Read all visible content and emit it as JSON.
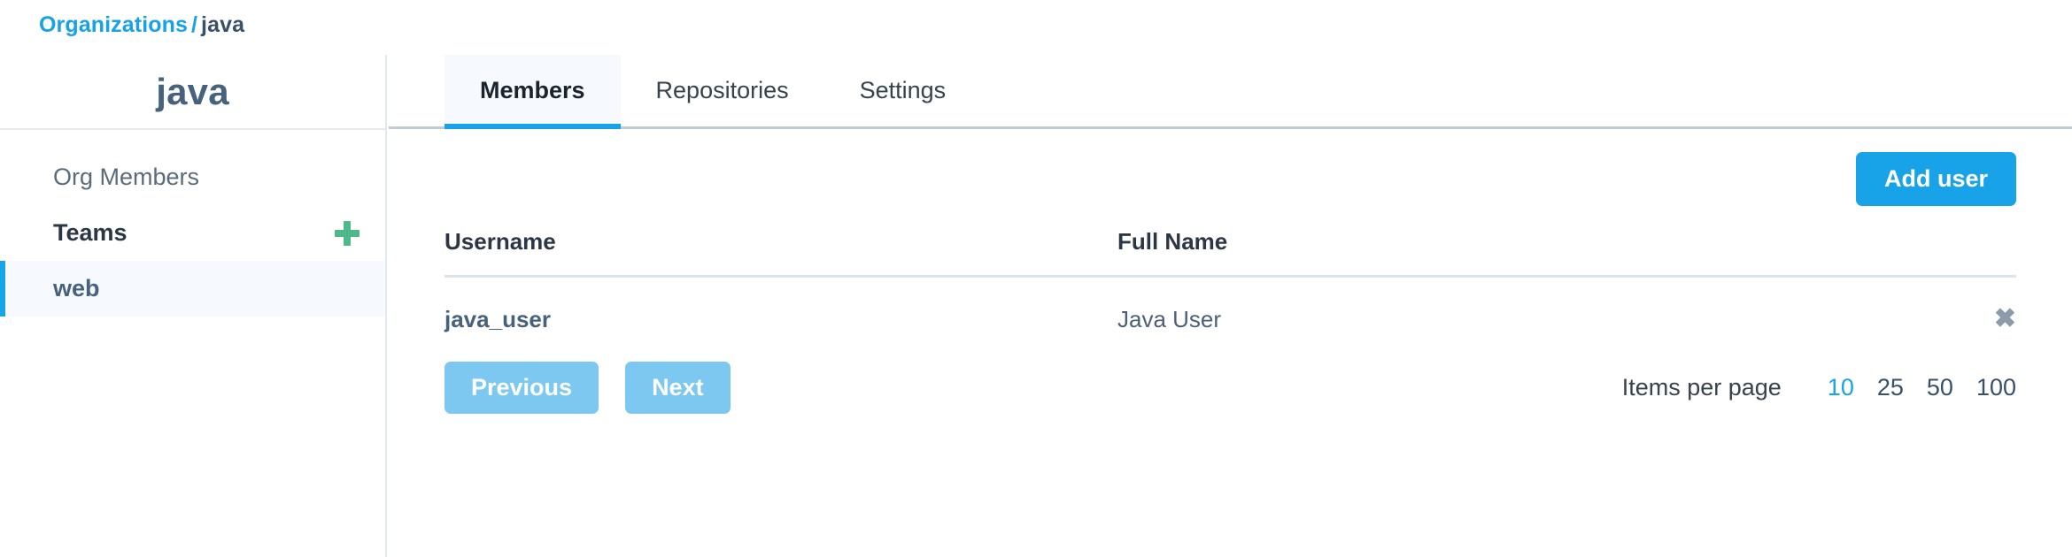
{
  "breadcrumb": {
    "root_label": "Organizations",
    "separator": "/",
    "current_label": "java"
  },
  "sidebar": {
    "org_title": "java",
    "items": [
      {
        "label": "Org Members",
        "state": "normal"
      },
      {
        "label": "Teams",
        "state": "strong",
        "action_icon": "plus-icon"
      },
      {
        "label": "web",
        "state": "active"
      }
    ]
  },
  "tabs": [
    {
      "label": "Members",
      "active": true
    },
    {
      "label": "Repositories",
      "active": false
    },
    {
      "label": "Settings",
      "active": false
    }
  ],
  "toolbar": {
    "add_user_label": "Add user"
  },
  "table": {
    "columns": [
      "Username",
      "Full Name",
      ""
    ],
    "rows": [
      {
        "username": "java_user",
        "full_name": "Java User",
        "remove_icon": "✖"
      }
    ]
  },
  "pagination": {
    "previous_label": "Previous",
    "next_label": "Next",
    "items_per_page_label": "Items per page",
    "options": [
      "10",
      "25",
      "50",
      "100"
    ],
    "selected": "10"
  },
  "colors": {
    "accent_blue": "#18a3e8",
    "link_blue": "#17a2e8",
    "muted_blue": "#7dc8f0",
    "green": "#4eb88c",
    "slate": "#46627c",
    "icon_gray": "#8c9bab"
  }
}
